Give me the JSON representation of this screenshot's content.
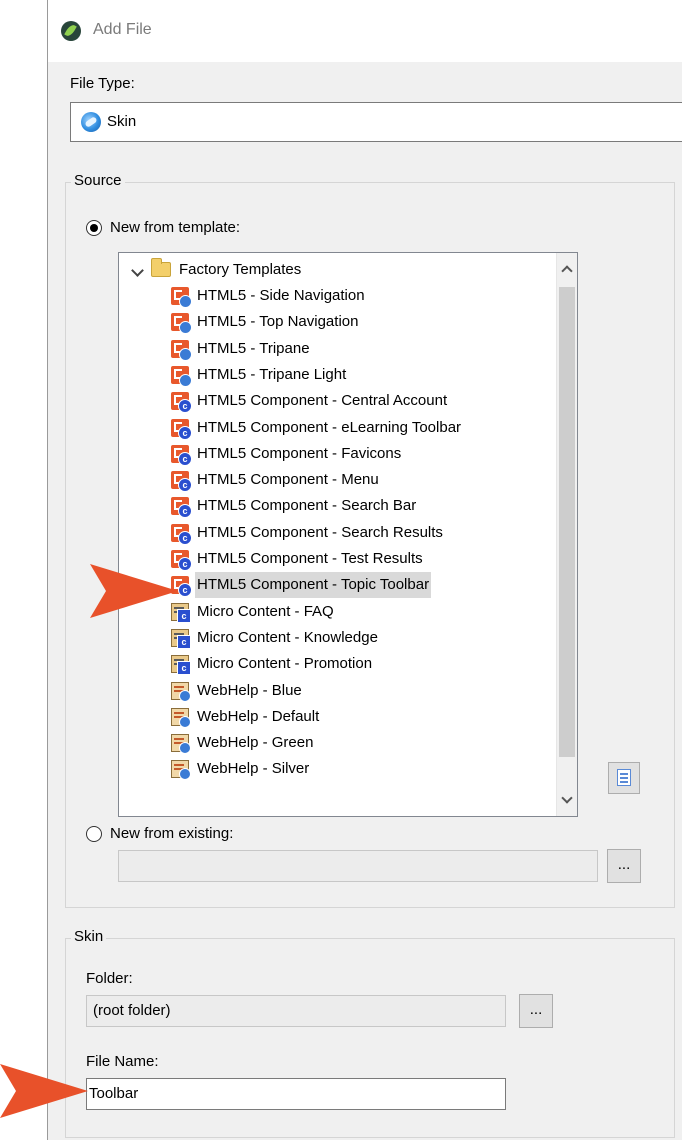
{
  "window": {
    "title": "Add File"
  },
  "file_type": {
    "label": "File Type:",
    "value": "Skin"
  },
  "source": {
    "group_label": "Source",
    "new_from_template": {
      "label": "New from template:",
      "selected": true
    },
    "tree": {
      "root": "Factory Templates",
      "items": [
        {
          "label": "HTML5 - Side Navigation",
          "icon": "html5-skin-icon"
        },
        {
          "label": "HTML5 - Top Navigation",
          "icon": "html5-skin-icon"
        },
        {
          "label": "HTML5 - Tripane",
          "icon": "html5-skin-icon"
        },
        {
          "label": "HTML5 - Tripane Light",
          "icon": "html5-skin-icon"
        },
        {
          "label": "HTML5 Component - Central Account",
          "icon": "html5-component-icon"
        },
        {
          "label": "HTML5 Component - eLearning Toolbar",
          "icon": "html5-component-icon"
        },
        {
          "label": "HTML5 Component - Favicons",
          "icon": "html5-component-icon"
        },
        {
          "label": "HTML5 Component - Menu",
          "icon": "html5-component-icon"
        },
        {
          "label": "HTML5 Component - Search Bar",
          "icon": "html5-component-icon"
        },
        {
          "label": "HTML5 Component - Search Results",
          "icon": "html5-component-icon"
        },
        {
          "label": "HTML5 Component - Test Results",
          "icon": "html5-component-icon"
        },
        {
          "label": "HTML5 Component - Topic Toolbar",
          "icon": "html5-component-icon",
          "selected": true
        },
        {
          "label": "Micro Content - FAQ",
          "icon": "micro-content-icon"
        },
        {
          "label": "Micro Content - Knowledge",
          "icon": "micro-content-icon"
        },
        {
          "label": "Micro Content - Promotion",
          "icon": "micro-content-icon"
        },
        {
          "label": "WebHelp - Blue",
          "icon": "webhelp-skin-icon"
        },
        {
          "label": "WebHelp - Default",
          "icon": "webhelp-skin-icon"
        },
        {
          "label": "WebHelp - Green",
          "icon": "webhelp-skin-icon"
        },
        {
          "label": "WebHelp - Silver",
          "icon": "webhelp-skin-icon"
        }
      ]
    },
    "new_from_existing": {
      "label": "New from existing:",
      "selected": false,
      "value": ""
    },
    "browse_label": "..."
  },
  "skin": {
    "group_label": "Skin",
    "folder_label": "Folder:",
    "folder_value": "(root folder)",
    "browse_label": "...",
    "file_name_label": "File Name:",
    "file_name_value": "Toolbar"
  },
  "colors": {
    "accent_arrow": "#e8512a",
    "selection": "#d9d9d9"
  }
}
